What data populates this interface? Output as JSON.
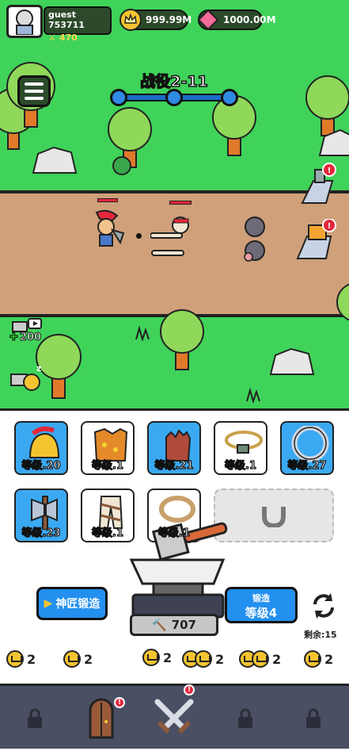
{
  "player": {
    "name": "guest 753711",
    "power": "470"
  },
  "currency": {
    "gold": "999.99M",
    "gems": "1000.00M"
  },
  "stage": {
    "title": "战役2-11"
  },
  "side": {
    "hammer_reward": "200"
  },
  "equipment": [
    {
      "id": "helmet",
      "label": "等级.20",
      "style": "blue"
    },
    {
      "id": "armor",
      "label": "等级.1",
      "style": "white"
    },
    {
      "id": "gloves",
      "label": "等级.21",
      "style": "blue"
    },
    {
      "id": "necklace",
      "label": "等级.1",
      "style": "white"
    },
    {
      "id": "ring",
      "label": "等级.27",
      "style": "blue"
    },
    {
      "id": "weapon",
      "label": "等级.23",
      "style": "blue"
    },
    {
      "id": "pants",
      "label": "等级.1",
      "style": "white"
    },
    {
      "id": "belt",
      "label": "等级.1",
      "style": "white"
    }
  ],
  "forge": {
    "master_button": "神匠锻造",
    "forge_label": "锻造",
    "forge_level": "等级4",
    "hammer_count": "707",
    "remaining": "剩余:15"
  },
  "rewards": [
    "2",
    "2",
    "2",
    "2",
    "2",
    "2"
  ],
  "colors": {
    "grass": "#3fd35a",
    "road": "#cfa07a",
    "accent": "#2390ef",
    "nav": "#4a4f63"
  },
  "nav": {
    "items": [
      "lock-icon",
      "door-icon",
      "crossed-swords-icon",
      "lock-icon",
      "lock-icon"
    ]
  }
}
